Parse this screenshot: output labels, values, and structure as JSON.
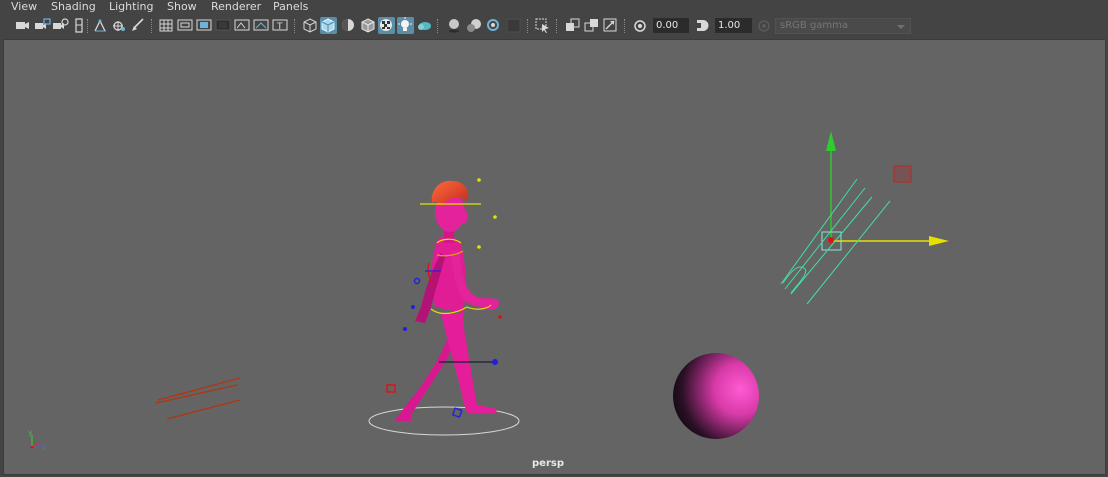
{
  "menu": {
    "items": [
      "View",
      "Shading",
      "Lighting",
      "Show",
      "Renderer",
      "Panels"
    ]
  },
  "toolbar": {
    "exposure_value": "0.00",
    "gamma_value": "1.00",
    "color_space": "sRGB gamma",
    "icons": [
      "camera-select-icon",
      "camera-attributes-icon",
      "bookmarks-icon",
      "image-plane-icon",
      "2d-pan-zoom-icon",
      "grease-pencil-icon",
      "grid-icon",
      "film-gate-icon",
      "resolution-gate-icon",
      "gate-mask-icon",
      "field-chart-icon",
      "safe-title-icon",
      "wireframe-icon",
      "smooth-shade-icon",
      "default-lighting-icon",
      "wireframe-on-shaded-icon",
      "textured-icon",
      "use-all-lights-icon",
      "xray-icon",
      "shadows-icon",
      "screen-space-ao-icon",
      "motion-blur-icon",
      "multisample-aa-icon",
      "isolate-select-icon",
      "xray-joints-icon",
      "xray-active-icon",
      "xray-components-icon",
      "exposure-icon",
      "gamma-icon",
      "color-management-icon"
    ]
  },
  "viewport": {
    "camera_label": "persp",
    "axis_labels": {
      "y": "y",
      "x": "x",
      "z": "z"
    },
    "background_color": "#646464"
  }
}
